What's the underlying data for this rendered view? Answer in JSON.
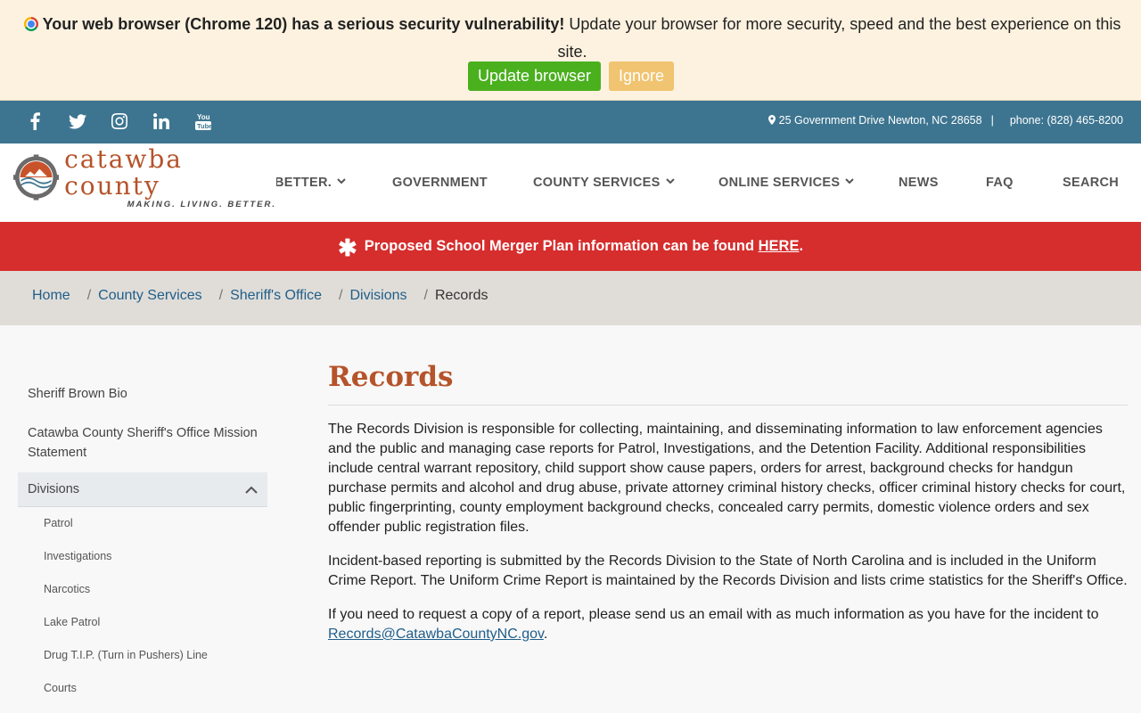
{
  "update_bar": {
    "bold": "Your web browser (Chrome 120) has a serious security vulnerability!",
    "rest": " Update your browser for more security, speed and the best experience on this site.",
    "update_label": "Update browser",
    "ignore_label": "Ignore"
  },
  "contact": {
    "address": "25 Government Drive Newton, NC 28658",
    "separator": "|",
    "phone": "phone: (828) 465-8200"
  },
  "logo": {
    "name": "catawba county",
    "tagline": "MAKING. LIVING. BETTER."
  },
  "nav": {
    "items": [
      "BETTER.",
      "GOVERNMENT",
      "COUNTY SERVICES",
      "ONLINE SERVICES",
      "NEWS",
      "FAQ",
      "SEARCH"
    ]
  },
  "alert": {
    "text": "Proposed School Merger Plan information can be found ",
    "link": "HERE",
    "end": "."
  },
  "breadcrumb": {
    "items": [
      "Home",
      "County Services",
      "Sheriff's Office",
      "Divisions"
    ],
    "current": "Records",
    "sep": "/"
  },
  "sidebar": {
    "items": [
      "Sheriff Brown Bio",
      "Catawba County Sheriff's Office Mission Statement"
    ],
    "active": "Divisions",
    "sub": [
      "Patrol",
      "Investigations",
      "Narcotics",
      "Lake Patrol",
      "Drug T.I.P. (Turn in Pushers) Line",
      "Courts"
    ]
  },
  "main": {
    "title": "Records",
    "p1": "The Records Division is responsible for collecting, maintaining, and disseminating information to law enforcement agencies and the public and managing case reports for Patrol, Investigations, and the Detention Facility. Additional responsibilities include central warrant repository, child support show cause papers, orders for arrest, background checks for handgun purchase permits and alcohol and drug abuse, private attorney criminal history checks, officer criminal history checks for court, public fingerprinting, county employment background checks, concealed carry permits, domestic violence orders and sex offender public registration files.",
    "p2": "Incident-based reporting is submitted by the Records Division to the State of North Carolina and is included in the Uniform Crime Report. The Uniform Crime Report is maintained by the Records Division and lists crime statistics for the Sheriff's Office.",
    "p3": "If you need to request a copy of a report, please send us an email with as much information as you have for the incident to ",
    "email": "Records@CatawbaCountyNC.gov",
    "p3_end": "."
  },
  "colors": {
    "accent": "#b5532a",
    "social_bar": "#3d7590",
    "alert": "#d62d2d",
    "link": "#1f5e8a"
  }
}
